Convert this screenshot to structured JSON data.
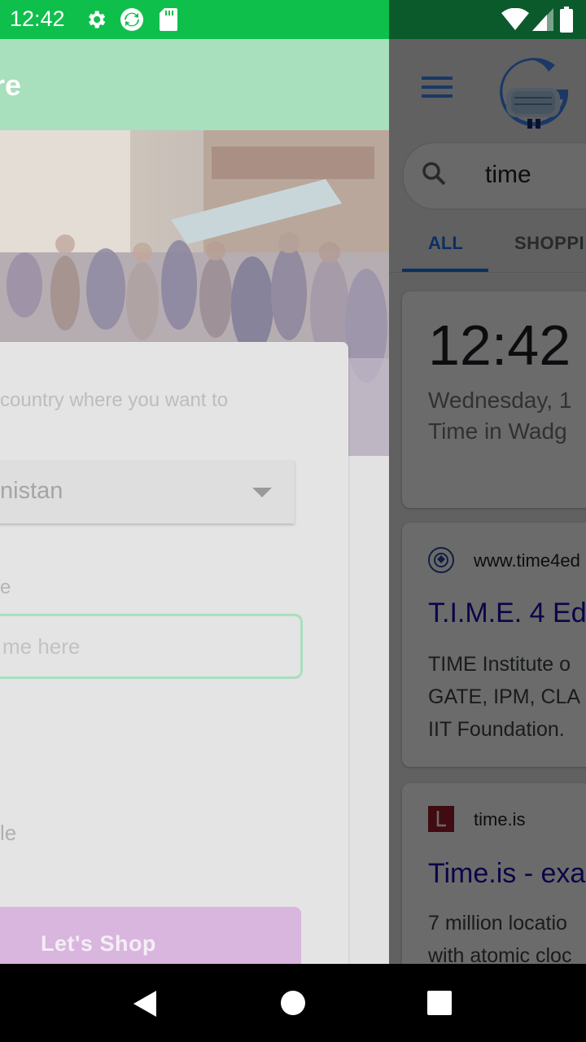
{
  "status_bar": {
    "time": "12:42",
    "colors": {
      "left_bg": "#0fbf4c",
      "right_bg": "#0b5a2c"
    }
  },
  "left_app": {
    "header_title": "re",
    "form_prompt": "country where you want to",
    "country_value": "nistan",
    "name_label": "e",
    "name_placeholder": "me here",
    "gender_label": "le",
    "shop_button": "Let's  Shop",
    "colors": {
      "accent": "#a8dfbd",
      "button": "#d9b6de"
    }
  },
  "right_app": {
    "search_query": "time",
    "tabs": [
      {
        "label": "ALL"
      },
      {
        "label": "SHOPPI"
      }
    ],
    "time_card": {
      "time": "12:42",
      "date": "Wednesday, 1",
      "place": "Time in Wadg"
    },
    "results": [
      {
        "url": "www.time4ed",
        "title": "T.I.M.E. 4 Ed",
        "snippet": [
          "TIME Institute o",
          "GATE, IPM, CLA",
          "IIT Foundation."
        ]
      },
      {
        "url": "time.is",
        "title": "Time.is - exa",
        "snippet": [
          "7 million locatio",
          "with atomic cloc"
        ]
      }
    ],
    "colors": {
      "link": "#1a0dab",
      "accent": "#1a73e8"
    }
  },
  "nav_bar": {
    "icons": [
      "back-icon",
      "home-icon",
      "recents-icon"
    ]
  }
}
